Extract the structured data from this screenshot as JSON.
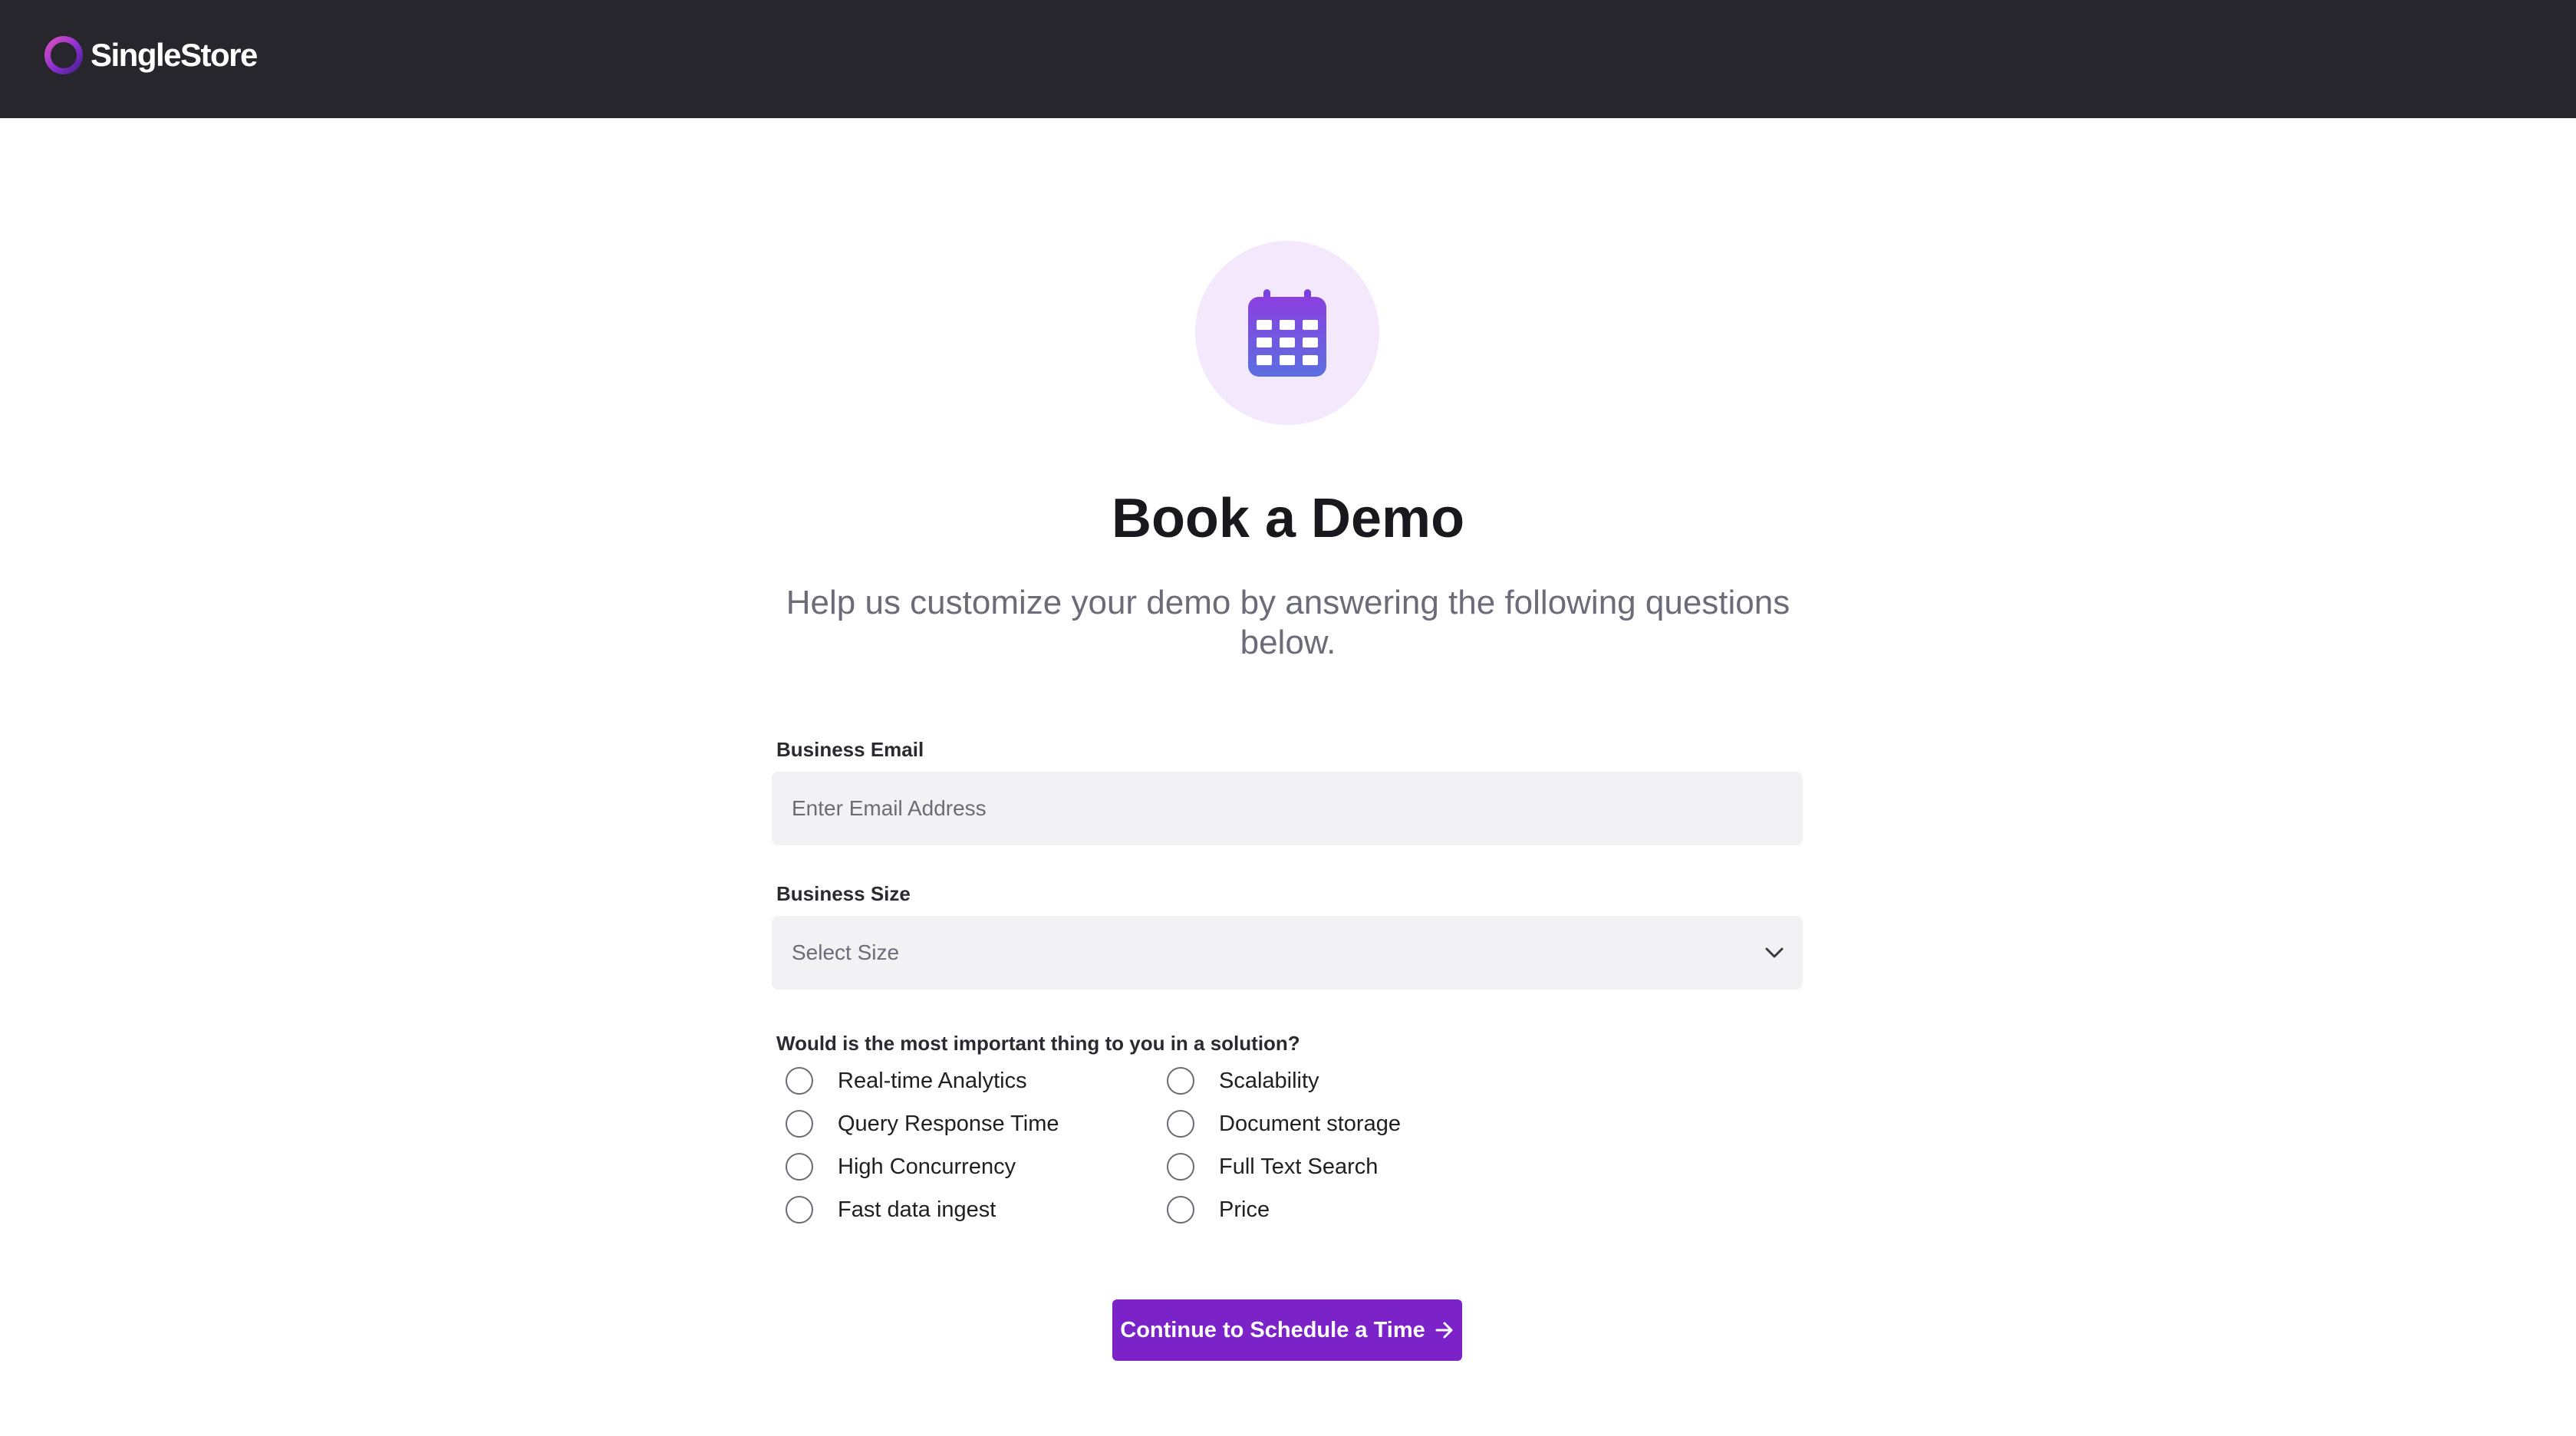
{
  "header": {
    "brand_name": "SingleStore",
    "logo_icon": "singlestore-logo-ring",
    "background_color": "#26262c"
  },
  "hero": {
    "icon": "calendar-icon",
    "icon_color": "#7d4de8",
    "circle_color": "#f4e9fc"
  },
  "page": {
    "title": "Book a Demo",
    "subtitle": "Help us customize your demo by answering the following questions below."
  },
  "form": {
    "email": {
      "label": "Business Email",
      "placeholder": "Enter Email Address",
      "value": ""
    },
    "size": {
      "label": "Business Size",
      "selected": "Select Size"
    },
    "question": {
      "label": "Would is the most important thing to you in a solution?",
      "options": [
        {
          "label": "Real-time Analytics",
          "checked": false
        },
        {
          "label": "Query Response Time",
          "checked": false
        },
        {
          "label": "High Concurrency",
          "checked": false
        },
        {
          "label": "Fast data ingest",
          "checked": false
        },
        {
          "label": "Scalability",
          "checked": false
        },
        {
          "label": "Document storage",
          "checked": false
        },
        {
          "label": "Full Text Search",
          "checked": false
        },
        {
          "label": "Price",
          "checked": false
        }
      ]
    },
    "submit": {
      "label": "Continue to Schedule a Time",
      "icon": "arrow-right-icon",
      "color": "#7b22c9"
    }
  }
}
